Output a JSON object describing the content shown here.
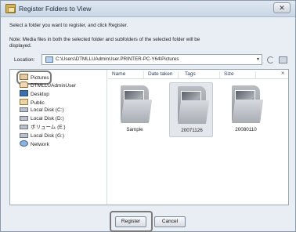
{
  "window": {
    "title": "Register Folders to View",
    "close_label": "✕"
  },
  "instruction": "Select a folder you want to register, and click Register.",
  "note": "Note: Media files in both the selected folder and subfolders of the selected folder will be displayed.",
  "location": {
    "label": "Location:",
    "path": "C:\\Users\\DTMLLUAdminUser.PRINTER-PC-Y64\\Pictures",
    "caret": "▾"
  },
  "tree": {
    "items": [
      {
        "label": "Pictures",
        "icon": "pictures-icon"
      },
      {
        "label": "DTMLLUAdminUser",
        "icon": "user-folder-icon"
      },
      {
        "label": "Desktop",
        "icon": "desktop-icon"
      },
      {
        "label": "Public",
        "icon": "public-folder-icon"
      },
      {
        "label": "Local Disk (C:)",
        "icon": "drive-icon"
      },
      {
        "label": "Local Disk (D:)",
        "icon": "drive-icon"
      },
      {
        "label": "ボリューム (E:)",
        "icon": "drive-icon"
      },
      {
        "label": "Local Disk (G:)",
        "icon": "drive-icon"
      },
      {
        "label": "Network",
        "icon": "network-icon"
      }
    ]
  },
  "columns": {
    "name": "Name",
    "date_taken": "Date taken",
    "tags": "Tags",
    "size": "Size",
    "more": "»"
  },
  "folders": [
    {
      "label": "Sample",
      "selected": false
    },
    {
      "label": "20071126",
      "selected": true
    },
    {
      "label": "20080110",
      "selected": false
    }
  ],
  "buttons": {
    "register": "Register",
    "cancel": "Cancel"
  }
}
